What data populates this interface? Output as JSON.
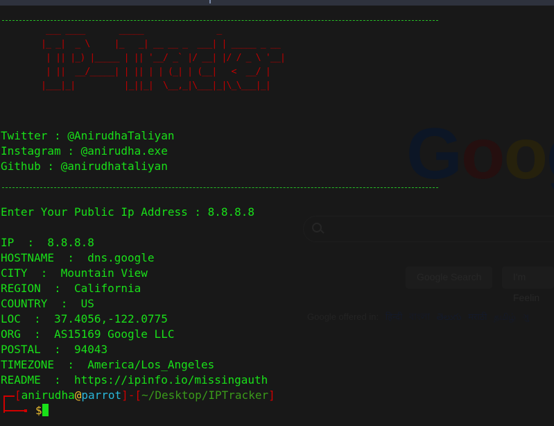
{
  "background_page": {
    "logo": [
      "G",
      "o",
      "o",
      "g"
    ],
    "search_icon": "search-icon",
    "buttons": [
      "Google Search",
      "I'm Feelin"
    ],
    "offered_label": "Google offered in:",
    "languages": [
      "हिन्दी",
      "বাংলা",
      "తెలుగు",
      "मराठी",
      "தமிழ்",
      "ગુ"
    ]
  },
  "terminal": {
    "banner": " ___ ____       _____               _\n|_ _|  _ \\     |_   _| __ __ _  ___| | _____ _ __\n | || |_) |_____ | || '__/ _` |/ __| |/ / _ \\ '__|\n | ||  __/_____| | || | | (_| | (__|   <  __/ |\n|___|_|          |_||_|  \\__,_|\\___|_|\\_\\___|_|",
    "social": [
      "Twitter : @AnirudhaTaliyan",
      "Instagram : @anirudha.exe",
      "Github : @anirudhataliyan"
    ],
    "input_prompt": "Enter Your Public Ip Address : 8.8.8.8",
    "results": [
      "IP  :  8.8.8.8",
      "HOSTNAME  :  dns.google",
      "CITY  :  Mountain View",
      "REGION  :  California",
      "COUNTRY  :  US",
      "LOC  :  37.4056,-122.0775",
      "ORG  :  AS15169 Google LLC",
      "POSTAL  :  94043",
      "TIMEZONE  :  America/Los_Angeles",
      "README  :  https://ipinfo.io/missingauth"
    ],
    "prompt": {
      "open_bracket": "[",
      "user": "anirudha",
      "at": "@",
      "host": "parrot",
      "close_bracket": "]",
      "dash": "-",
      "path_open": "[",
      "path": "~/Desktop/IPTracker",
      "path_close": "]",
      "symbol": "$"
    }
  }
}
